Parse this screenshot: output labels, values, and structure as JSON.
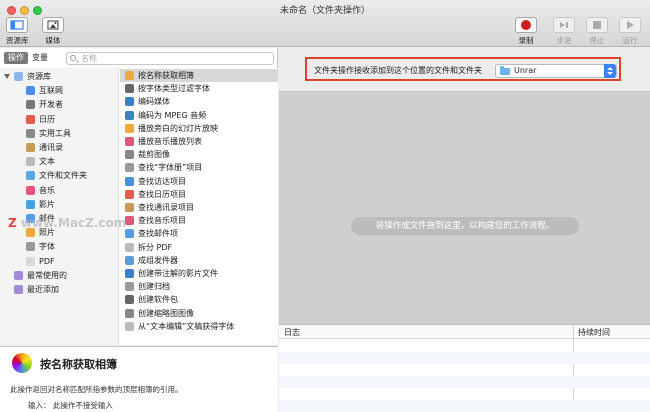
{
  "window": {
    "title": "未命名（文件夹操作）"
  },
  "toolbar": {
    "library": "资源库",
    "media": "媒体",
    "record": "录制",
    "step": "步进",
    "stop": "停止",
    "run": "运行"
  },
  "left_panel": {
    "segments": [
      "操作",
      "变量"
    ],
    "search_placeholder": "名称",
    "categories": [
      {
        "label": "资源库",
        "level": 0,
        "color": "#8bb8e8"
      },
      {
        "label": "互联网",
        "level": 1,
        "color": "#4c90e0"
      },
      {
        "label": "开发者",
        "level": 1,
        "color": "#777777"
      },
      {
        "label": "日历",
        "level": 1,
        "color": "#e55b4d"
      },
      {
        "label": "实用工具",
        "level": 1,
        "color": "#8a8a8a"
      },
      {
        "label": "通讯录",
        "level": 1,
        "color": "#c79a5a"
      },
      {
        "label": "文本",
        "level": 1,
        "color": "#bbbbbb"
      },
      {
        "label": "文件和文件夹",
        "level": 1,
        "color": "#5aa7e8"
      },
      {
        "label": "音乐",
        "level": 1,
        "color": "#e5567c"
      },
      {
        "label": "影片",
        "level": 1,
        "color": "#4aa0d8"
      },
      {
        "label": "邮件",
        "level": 1,
        "color": "#5b9be0"
      },
      {
        "label": "照片",
        "level": 1,
        "color": "#f2a93b"
      },
      {
        "label": "字体",
        "level": 1,
        "color": "#999999"
      },
      {
        "label": "PDF",
        "level": 1,
        "color": "#d8d8d8"
      },
      {
        "label": "最常使用的",
        "level": 0,
        "color": "#a38ad8"
      },
      {
        "label": "最近添加",
        "level": 0,
        "color": "#a38ad8"
      }
    ],
    "actions": [
      {
        "label": "按名称获取相簿",
        "color": "#f2a93b"
      },
      {
        "label": "按字体类型过滤字体",
        "color": "#666666"
      },
      {
        "label": "编码媒体",
        "color": "#3d7fc4"
      },
      {
        "label": "编码为 MPEG 音频",
        "color": "#3d7fc4"
      },
      {
        "label": "播放旁白的幻灯片放映",
        "color": "#f2a93b"
      },
      {
        "label": "播放音乐播放列表",
        "color": "#e5567c"
      },
      {
        "label": "裁剪图像",
        "color": "#888888"
      },
      {
        "label": "查找“字体册”项目",
        "color": "#999999"
      },
      {
        "label": "查找访达项目",
        "color": "#4a90e2"
      },
      {
        "label": "查找日历项目",
        "color": "#e55b4d"
      },
      {
        "label": "查找通讯录项目",
        "color": "#c79a5a"
      },
      {
        "label": "查找音乐项目",
        "color": "#e5567c"
      },
      {
        "label": "查找邮件项",
        "color": "#5b9be0"
      },
      {
        "label": "拆分 PDF",
        "color": "#bbbbbb"
      },
      {
        "label": "成组发件器",
        "color": "#5b9be0"
      },
      {
        "label": "创建带注解的影片文件",
        "color": "#3d7fc4"
      },
      {
        "label": "创建归档",
        "color": "#999999"
      },
      {
        "label": "创建软件包",
        "color": "#666666"
      },
      {
        "label": "创建缩略图图像",
        "color": "#888888"
      },
      {
        "label": "从“文本编辑”文稿获得字体",
        "color": "#bbbbbb"
      }
    ]
  },
  "description": {
    "title": "按名称获取相簿",
    "text": "此操作返回对名称匹配所指参数的顶层相簿的引用。",
    "input": "输入： 此操作不接受输入"
  },
  "workflow": {
    "receive_label": "文件夹操作接收添加到这个位置的文件和文件夹",
    "folder_value": "Unrar",
    "drop_hint": "将操作或文件拖到这里，以构建您的工作流程。"
  },
  "log": {
    "col_log": "日志",
    "col_duration": "持续时间"
  },
  "watermark": {
    "z": "Z",
    "text": "www.MacZ.com"
  },
  "colors": {
    "highlight_box": "#d9442a",
    "record_red": "#cc1f1f",
    "popup_blue": "#3a82f7"
  }
}
